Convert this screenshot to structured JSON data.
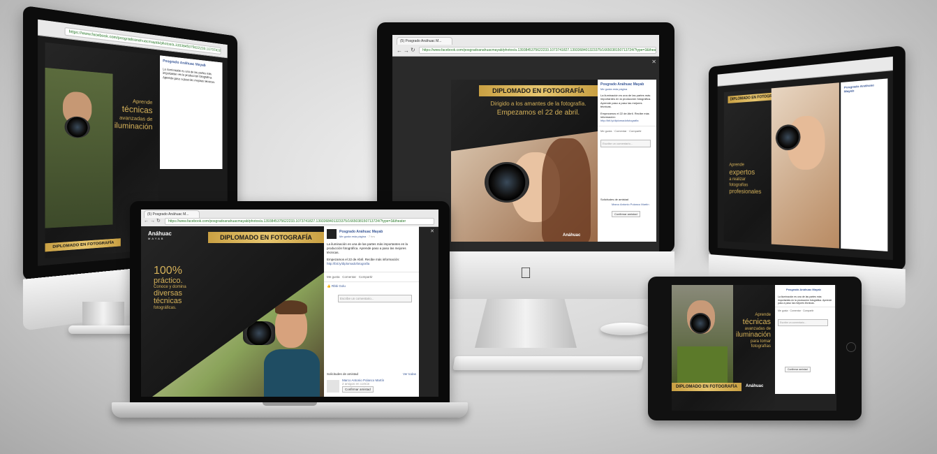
{
  "browser": {
    "tab_title": "(5) Posgrado Anáhuac M...",
    "url": "https://www.facebook.com/posgradoanahuacmayab/photos/a.1393845375622233.1073741827.1393368401323375/1665038150713724/?type=3&theater"
  },
  "post": {
    "page_name": "Posgrado Anáhuac Mayab",
    "like_page": "Me gusta esta página",
    "time": "7 hrs",
    "body": "La iluminación es una de las partes más importantes en la producción fotográfica. Aprende paso a paso las mejores técnicas.",
    "cta": "Empezamos el 22 de Abril. Recibe más información:",
    "link": "http://bit.ly/diplomadofotografia",
    "actions": {
      "like": "Me gusta",
      "comment": "Comentar",
      "share": "Compartir"
    },
    "liker": "Rbbi Golu",
    "comment_placeholder": "Escribe un comentario...",
    "friend_requests": {
      "heading": "Solicitudes de amistad",
      "see_all": "Ver todas",
      "name": "Marco Antonio Polanco Martín",
      "mutual": "2 amigos en común",
      "confirm": "Confirmar amistad"
    }
  },
  "ads": {
    "title": "DIPLOMADO EN FOTOGRAFÍA",
    "laptop_big": "100%",
    "laptop_line1": "práctico.",
    "laptop_line2": "Conoce y domina",
    "laptop_line3": "diversas",
    "laptop_line4": "técnicas",
    "laptop_line5": "fotográficas.",
    "imac_line1": "Dirigido a los amantes de la fotografía.",
    "imac_line2": "Empezamos el 22 de abril.",
    "tablet_line1": "Aprende",
    "tablet_line2": "técnicas",
    "tablet_line3": "avanzadas de",
    "tablet_line4": "iluminación",
    "tablet_line5": "para tomar",
    "tablet_line6": "fotografías",
    "right_line1": "Aprende",
    "right_line2": "expertos",
    "right_line3": "a realizar",
    "right_line4": "fotografías",
    "right_line5": "profesionales",
    "brand": "Anáhuac",
    "brand_sub": "MAYAB",
    "brand_tag": "POSGRADO Y EDUCACIÓN CONTINUA"
  },
  "icons": {
    "apple": "apple-logo-icon",
    "back": "back-arrow-icon",
    "forward": "forward-arrow-icon",
    "reload": "reload-icon",
    "close": "close-icon",
    "like": "thumbs-up-icon"
  },
  "colors": {
    "gold": "#d6b25a",
    "fb_blue": "#3b5998",
    "dark": "#1b1b1b"
  }
}
